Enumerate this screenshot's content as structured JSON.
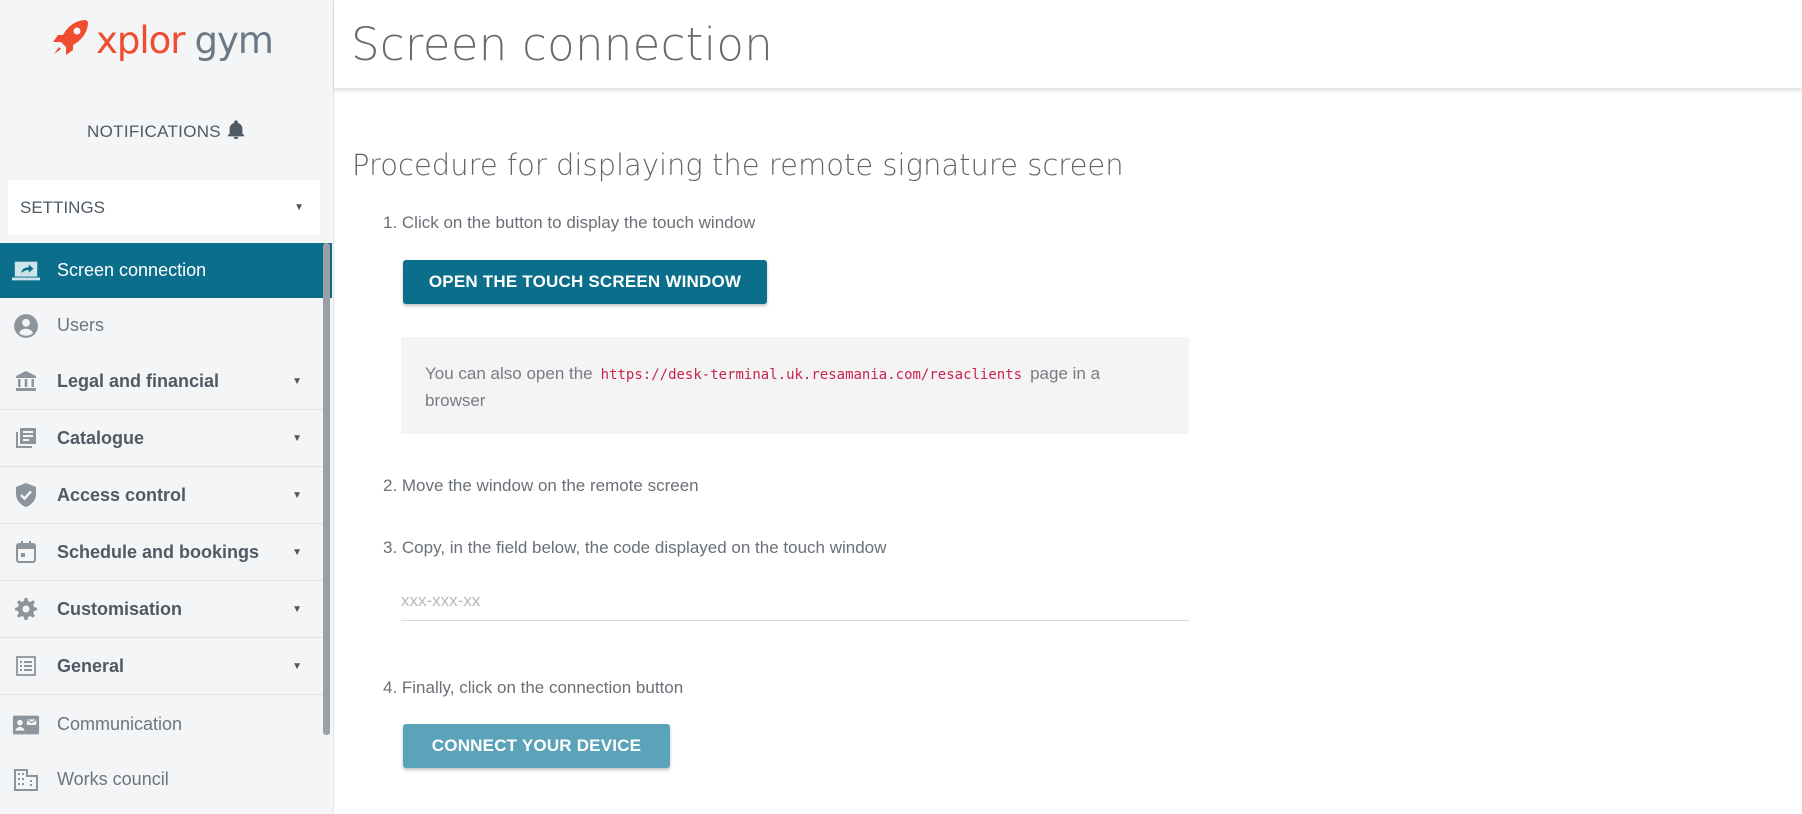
{
  "brand": {
    "word1": "xplor",
    "word2": "gym",
    "accent": "#ef4d2f"
  },
  "sidebar": {
    "notifications_label": "NOTIFICATIONS",
    "settings_select": "SETTINGS",
    "items": [
      {
        "label": "Screen connection",
        "icon": "laptop-share-icon",
        "active": true
      },
      {
        "label": "Users",
        "icon": "account-circle-icon"
      },
      {
        "label": "Legal and financial",
        "icon": "bank-icon",
        "expandable": true
      },
      {
        "label": "Catalogue",
        "icon": "library-books-icon",
        "expandable": true
      },
      {
        "label": "Access control",
        "icon": "shield-check-icon",
        "expandable": true
      },
      {
        "label": "Schedule and bookings",
        "icon": "calendar-icon",
        "expandable": true
      },
      {
        "label": "Customisation",
        "icon": "gear-icon",
        "expandable": true
      },
      {
        "label": "General",
        "icon": "list-icon",
        "expandable": true
      },
      {
        "label": "Communication",
        "icon": "contact-mail-icon"
      },
      {
        "label": "Works council",
        "icon": "office-building-icon"
      }
    ],
    "active_color": "#0b6e8a"
  },
  "main": {
    "page_title": "Screen connection",
    "section_title": "Procedure for displaying the remote signature screen",
    "step1": "1. Click on the button to display the touch window",
    "open_button": "OPEN THE TOUCH SCREEN WINDOW",
    "info_prefix": "You can also open the",
    "info_url": "https://desk-terminal.uk.resamania.com/resaclients",
    "info_suffix_1": "page in a",
    "info_suffix_2": "browser",
    "step2": "2. Move the window on the remote screen",
    "step3": "3. Copy, in the field below, the code displayed on the touch window",
    "code_placeholder": "xxx-xxx-xx",
    "step4": "4. Finally, click on the connection button",
    "connect_button": "CONNECT YOUR DEVICE"
  }
}
